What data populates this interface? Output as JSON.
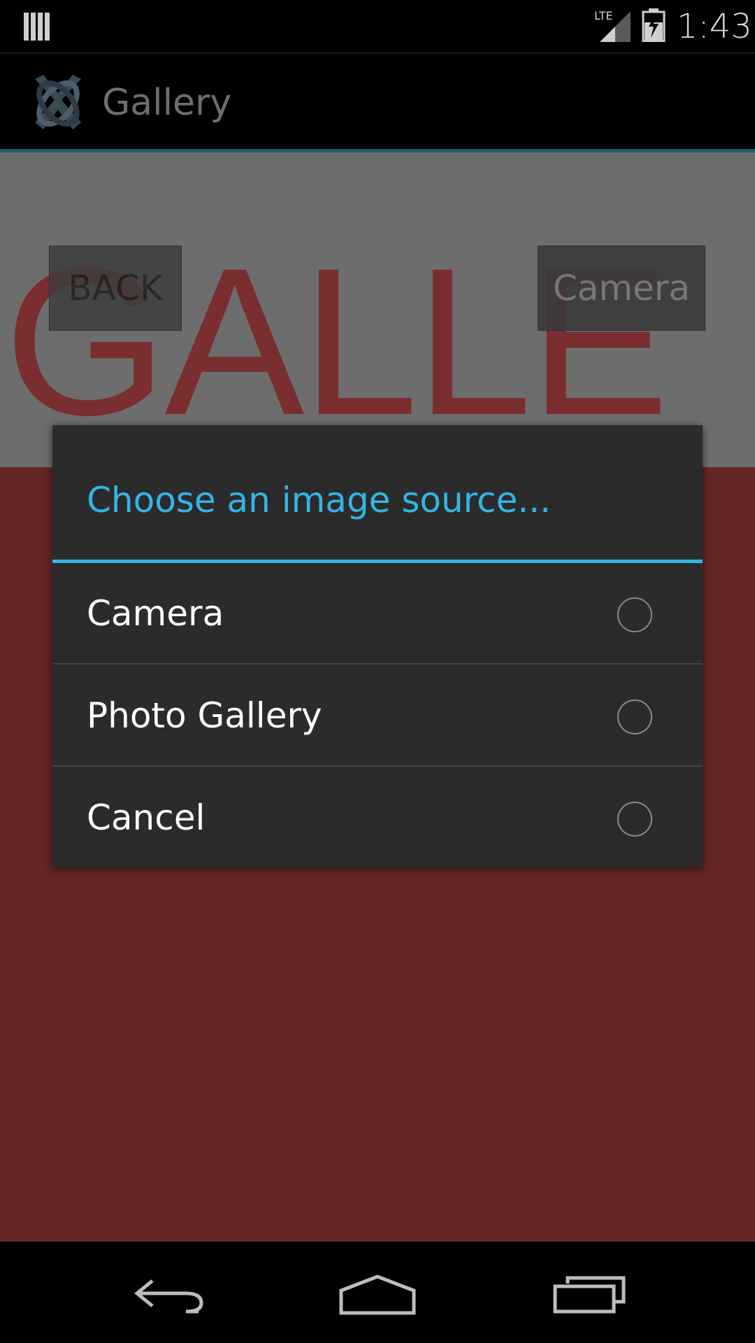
{
  "status_bar": {
    "time": "1:43",
    "network_label": "LTE",
    "icons": [
      "notification-bars-icon",
      "lte-signal-icon",
      "battery-charging-icon"
    ]
  },
  "action_bar": {
    "title": "Gallery",
    "app_icon": "app-logo-icon"
  },
  "content": {
    "background_text": "GALLE",
    "back_button": "BACK",
    "camera_button": "Camera"
  },
  "dialog": {
    "title": "Choose an image source...",
    "options": [
      {
        "label": "Camera",
        "selected": false
      },
      {
        "label": "Photo Gallery",
        "selected": false
      },
      {
        "label": "Cancel",
        "selected": false
      }
    ]
  },
  "nav_bar": {
    "icons": [
      "back-icon",
      "home-icon",
      "recent-apps-icon"
    ]
  },
  "colors": {
    "accent": "#33b5e5",
    "content_top": "#6d6d6d",
    "content_bottom": "#642627",
    "dialog_bg": "#2b2b2b"
  }
}
